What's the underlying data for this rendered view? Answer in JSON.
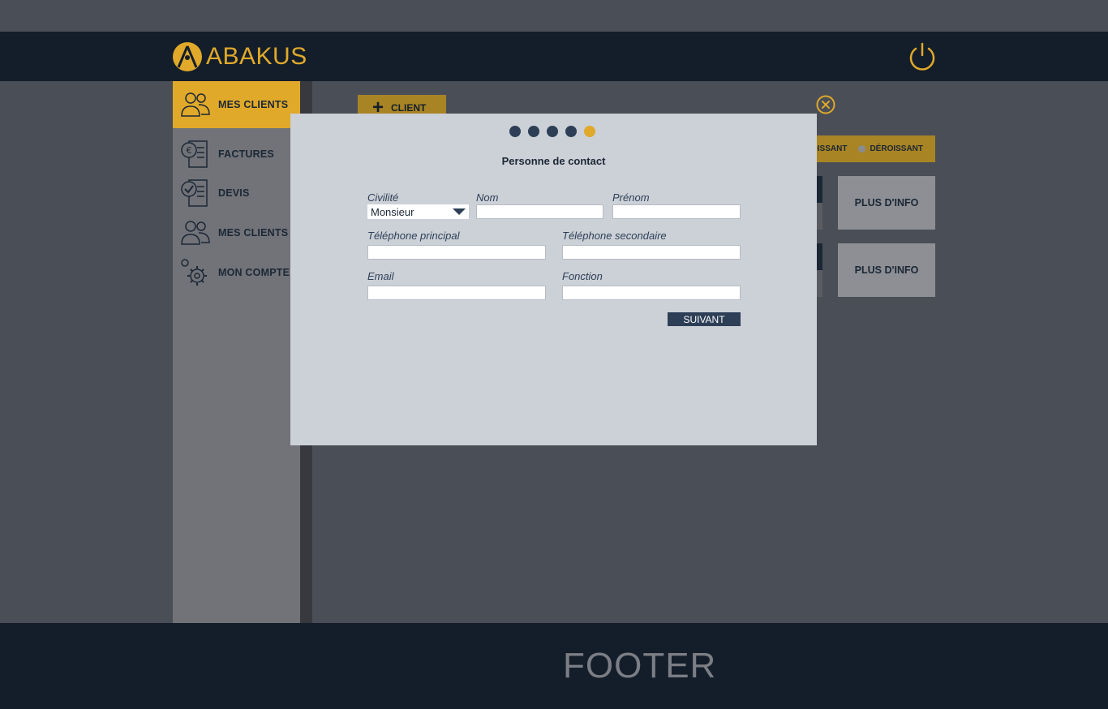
{
  "header": {
    "logo_text": "ABAKUS",
    "logo_icon": "abakus-logo-icon",
    "power_icon": "power-icon"
  },
  "sidebar": {
    "items": [
      {
        "label": "MES CLIENTS",
        "icon": "clients-icon",
        "active": true
      },
      {
        "label": "FACTURES",
        "icon": "invoice-icon",
        "active": false
      },
      {
        "label": "DEVIS",
        "icon": "quote-icon",
        "active": false
      },
      {
        "label": "MES CLIENTS",
        "icon": "clients-icon",
        "active": false
      },
      {
        "label": "MON COMPTE",
        "icon": "gear-icon",
        "active": false
      }
    ]
  },
  "main": {
    "add_client_label": "CLIENT",
    "filter": {
      "option1": "OISSANT",
      "option2": "DÉROISSANT"
    },
    "cards": [
      {
        "info_label": "PLUS D'INFO"
      },
      {
        "info_label": "PLUS D'INFO"
      }
    ]
  },
  "modal": {
    "steps_total": 5,
    "current_step": 5,
    "title": "Personne de contact",
    "fields": {
      "civilite": {
        "label": "Civilité",
        "value": "Monsieur"
      },
      "nom": {
        "label": "Nom",
        "value": ""
      },
      "prenom": {
        "label": "Prénom",
        "value": ""
      },
      "tel_principal": {
        "label": "Téléphone principal",
        "value": ""
      },
      "tel_secondaire": {
        "label": "Téléphone secondaire",
        "value": ""
      },
      "email": {
        "label": "Email",
        "value": ""
      },
      "fonction": {
        "label": "Fonction",
        "value": ""
      }
    },
    "next_label": "SUIVANT"
  },
  "footer": {
    "text": "FOOTER"
  },
  "colors": {
    "accent": "#e0a92a",
    "navy": "#141e2a",
    "modal_bg": "#ccd0d7"
  }
}
